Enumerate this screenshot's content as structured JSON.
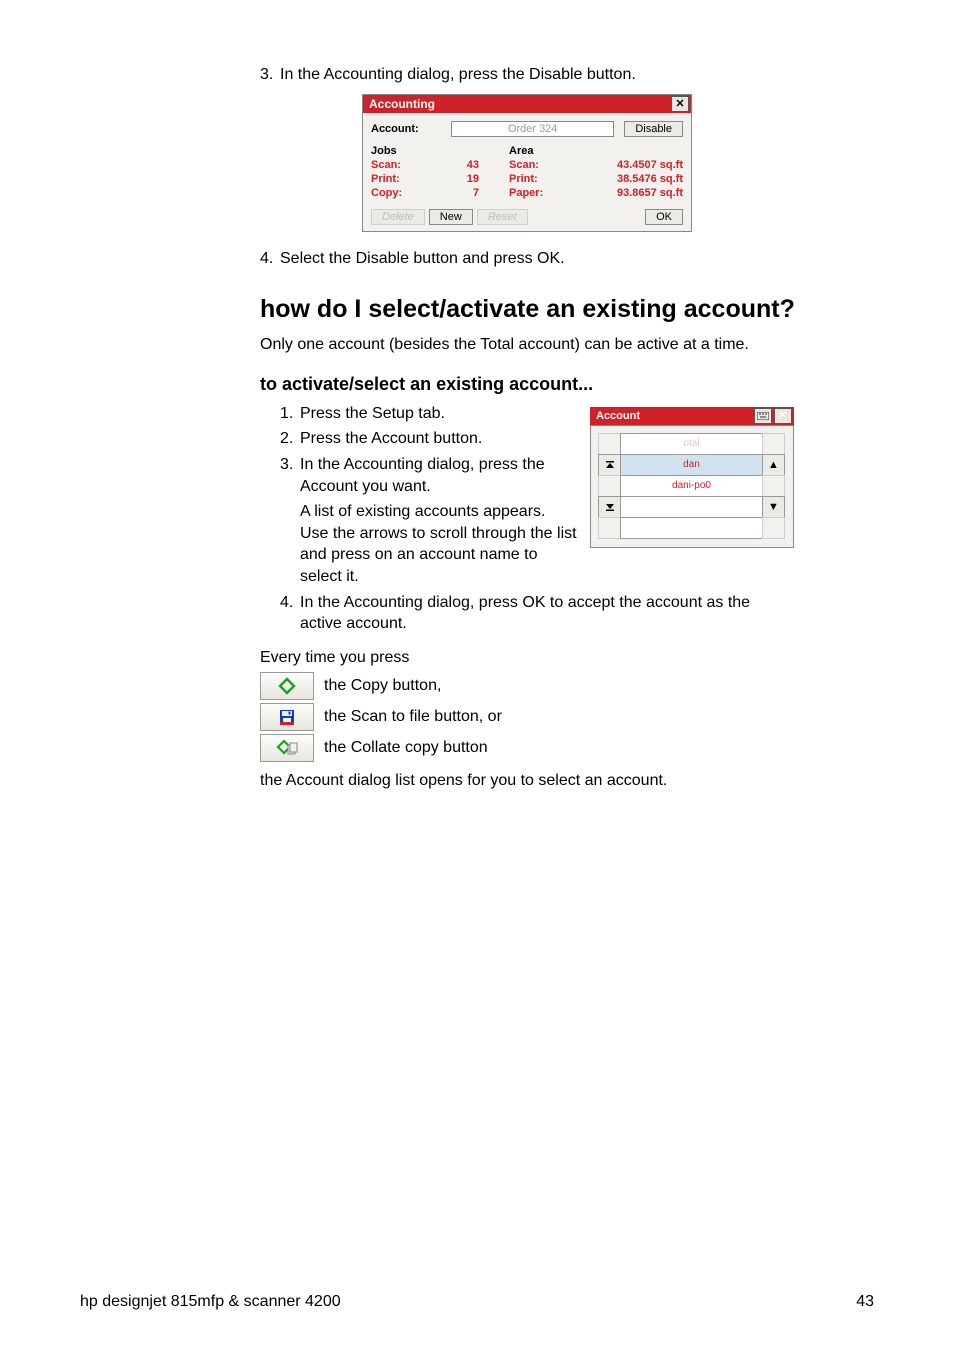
{
  "steps_top": {
    "s3": "In the Accounting dialog, press the Disable button.",
    "s4": "Select the Disable button and press OK."
  },
  "accounting_dialog": {
    "title": "Accounting",
    "close": "✕",
    "account_label": "Account:",
    "account_value": "Order 324",
    "disable_btn": "Disable",
    "jobs_hdr": "Jobs",
    "area_hdr": "Area",
    "rows": {
      "scan_lbl": "Scan:",
      "scan_jobs": "43",
      "scan_area": "43.4507 sq.ft",
      "print_lbl": "Print:",
      "print_jobs": "19",
      "print_area": "38.5476 sq.ft",
      "copy_lbl": "Copy:",
      "copy_jobs": "7",
      "paper_lbl": "Paper:",
      "paper_area": "93.8657 sq.ft"
    },
    "btn_delete": "Delete",
    "btn_new": "New",
    "btn_reset": "Reset",
    "btn_ok": "OK"
  },
  "section_heading": "how do I select/activate an existing account?",
  "section_intro": "Only one account (besides the Total account) can be active at a time.",
  "sub_heading": "to activate/select an existing account...",
  "steps_activate": {
    "s1": "Press the Setup tab.",
    "s2": "Press the Account button.",
    "s3a": "In the Accounting dialog, press the Account you want.",
    "s3b": "A list of existing accounts appears. Use the arrows to scroll through the list and press on an account name to select it.",
    "s4": "In the Accounting dialog, press OK to accept the account as the active account."
  },
  "account_picker": {
    "title": "Account",
    "items": [
      "otal",
      "dan",
      "dani-po0",
      "",
      ""
    ]
  },
  "every_time": "Every time you press",
  "example_buttons": {
    "copy": "the Copy button,",
    "scan": "the Scan to file button, or",
    "collate": "the Collate copy button"
  },
  "closing": "the Account dialog list opens for you to select an account.",
  "footer_left": "hp designjet 815mfp & scanner 4200",
  "footer_right": "43"
}
